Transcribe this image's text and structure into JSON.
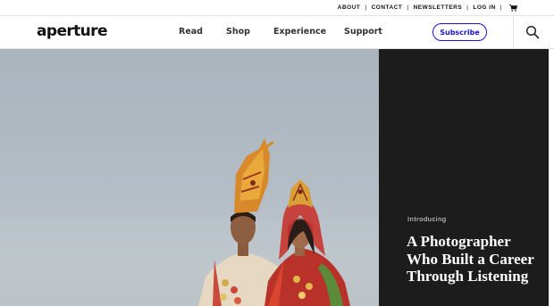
{
  "utility_bar": {
    "links": [
      "ABOUT",
      "CONTACT",
      "NEWSLETTERS",
      "LOG IN"
    ],
    "cart_icon": "cart-icon"
  },
  "header": {
    "logo": "aperture",
    "nav": [
      "Read",
      "Shop",
      "Experience",
      "Support"
    ],
    "subscribe_label": "Subscribe",
    "search_icon": "search-icon"
  },
  "hero": {
    "kicker": "Introducing",
    "headline": "A Photographer Who Built a Career Through Listening",
    "image": "photo of a bride and groom in traditional wedding attire with ornate headdresses against a pale sky"
  },
  "colors": {
    "accent": "#1a12e0",
    "panel": "#1c1c1c",
    "text": "#111111"
  }
}
